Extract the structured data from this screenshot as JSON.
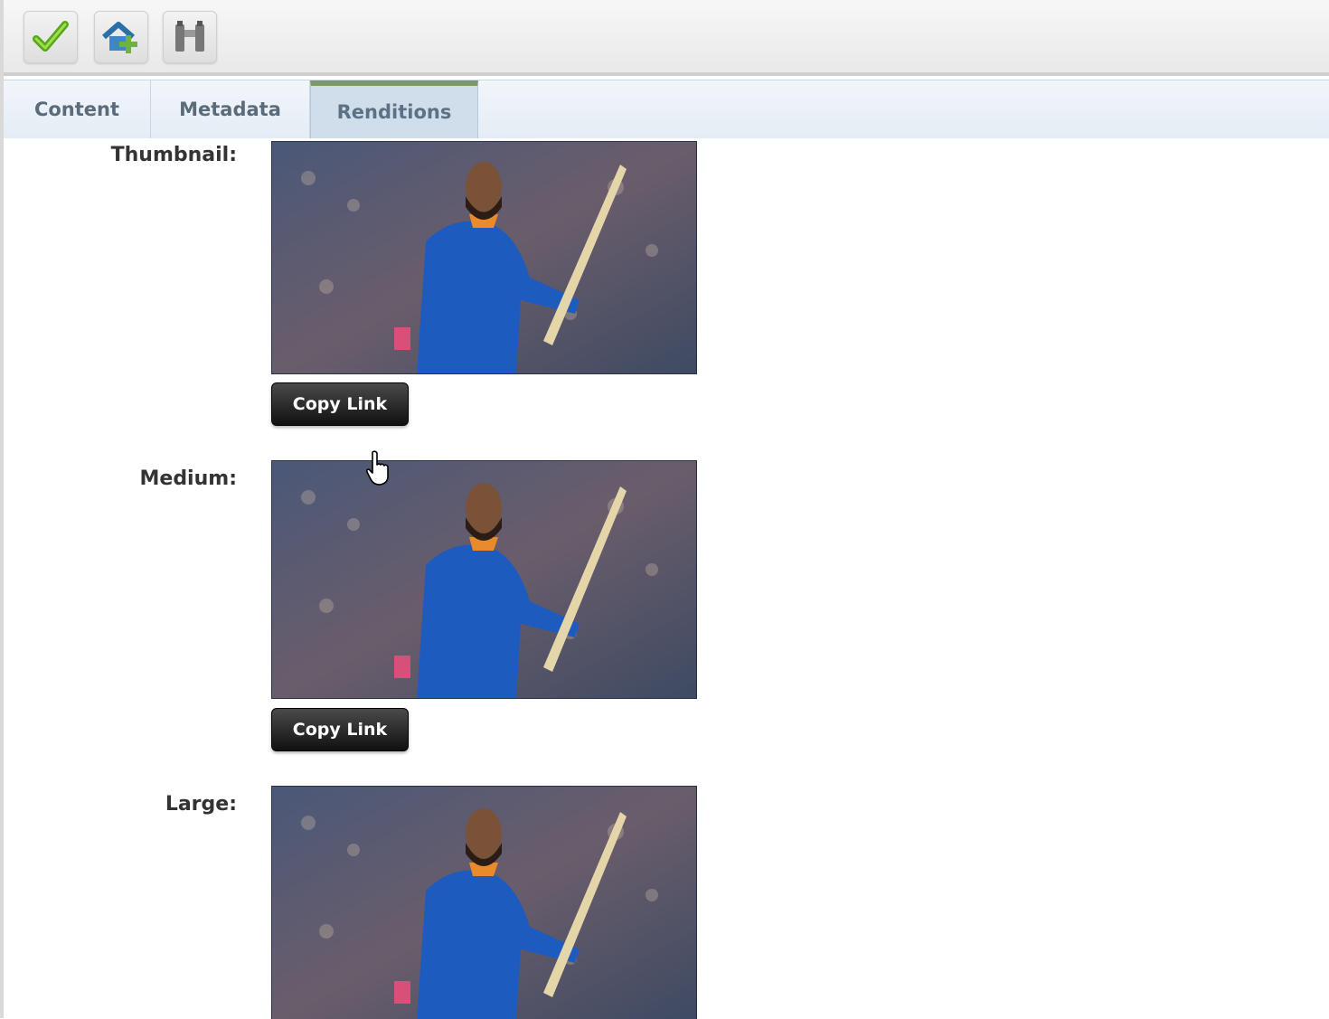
{
  "toolbar": {
    "buttons": [
      {
        "icon": "checkmark-icon",
        "title": "save"
      },
      {
        "icon": "home-add-icon",
        "title": "add"
      },
      {
        "icon": "binoculars-icon",
        "title": "find"
      }
    ]
  },
  "tabs": [
    {
      "label": "Content",
      "active": false
    },
    {
      "label": "Metadata",
      "active": false
    },
    {
      "label": "Renditions",
      "active": true
    }
  ],
  "renditions": [
    {
      "label": "Thumbnail:",
      "button_label": "Copy Link"
    },
    {
      "label": "Medium:",
      "button_label": "Copy Link"
    },
    {
      "label": "Large:",
      "button_label": ""
    }
  ],
  "colors": {
    "active_tab_accent": "#7b9a67",
    "copy_button": "#111111",
    "jersey_blue": "#1e5bbf"
  }
}
